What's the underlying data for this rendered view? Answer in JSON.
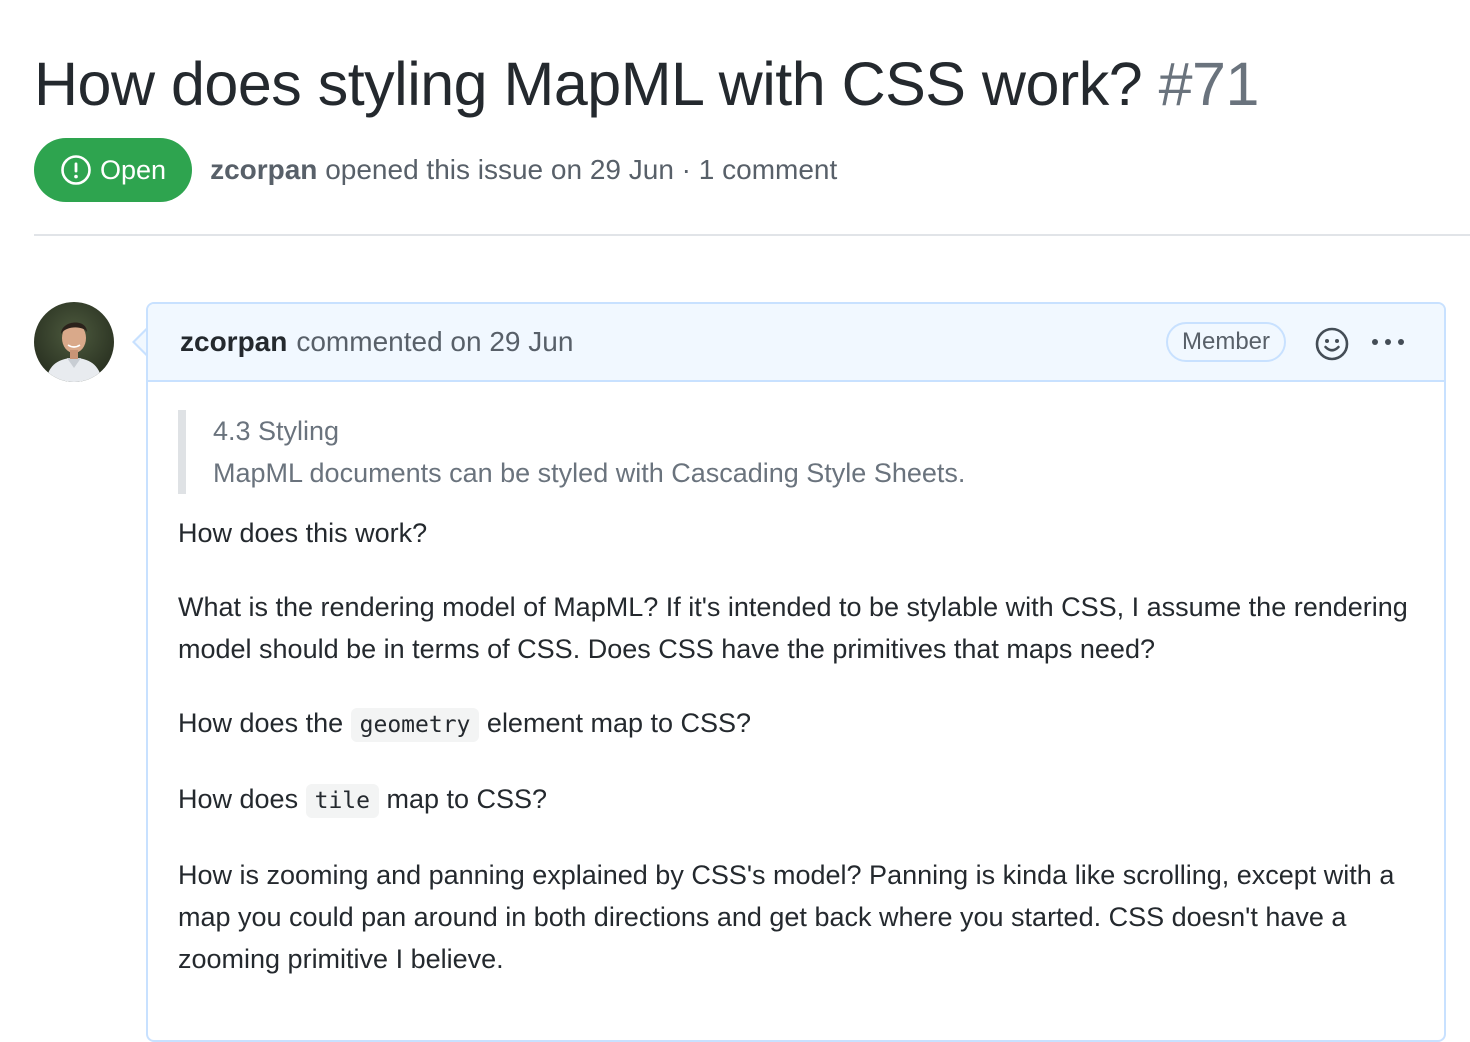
{
  "issue": {
    "title": "How does styling MapML with CSS work?",
    "number": "#71",
    "state": "Open",
    "author": "zcorpan",
    "meta_suffix": "opened this issue on 29 Jun · 1 comment",
    "state_color": "#2ea44f"
  },
  "comment": {
    "author": "zcorpan",
    "action": "commented on 29 Jun",
    "role_badge": "Member",
    "reaction_icon": "smiley-icon",
    "more_icon": "kebab-horizontal-icon",
    "quote": {
      "heading": "4.3 Styling",
      "text": "MapML documents can be styled with Cascading Style Sheets."
    },
    "paragraphs": [
      "How does this work?",
      "What is the rendering model of MapML? If it's intended to be stylable with CSS, I assume the rendering model should be in terms of CSS. Does CSS have the primitives that maps need?"
    ],
    "geometry_question": {
      "before": "How does the",
      "code": "geometry",
      "after": "element map to CSS?"
    },
    "tile_question": {
      "before": "How does",
      "code": "tile",
      "after": "map to CSS?"
    },
    "zoom_paragraph": "How is zooming and panning explained by CSS's model? Panning is kinda like scrolling, except with a map you could pan around in both directions and get back where you started. CSS doesn't have a zooming primitive I believe."
  }
}
